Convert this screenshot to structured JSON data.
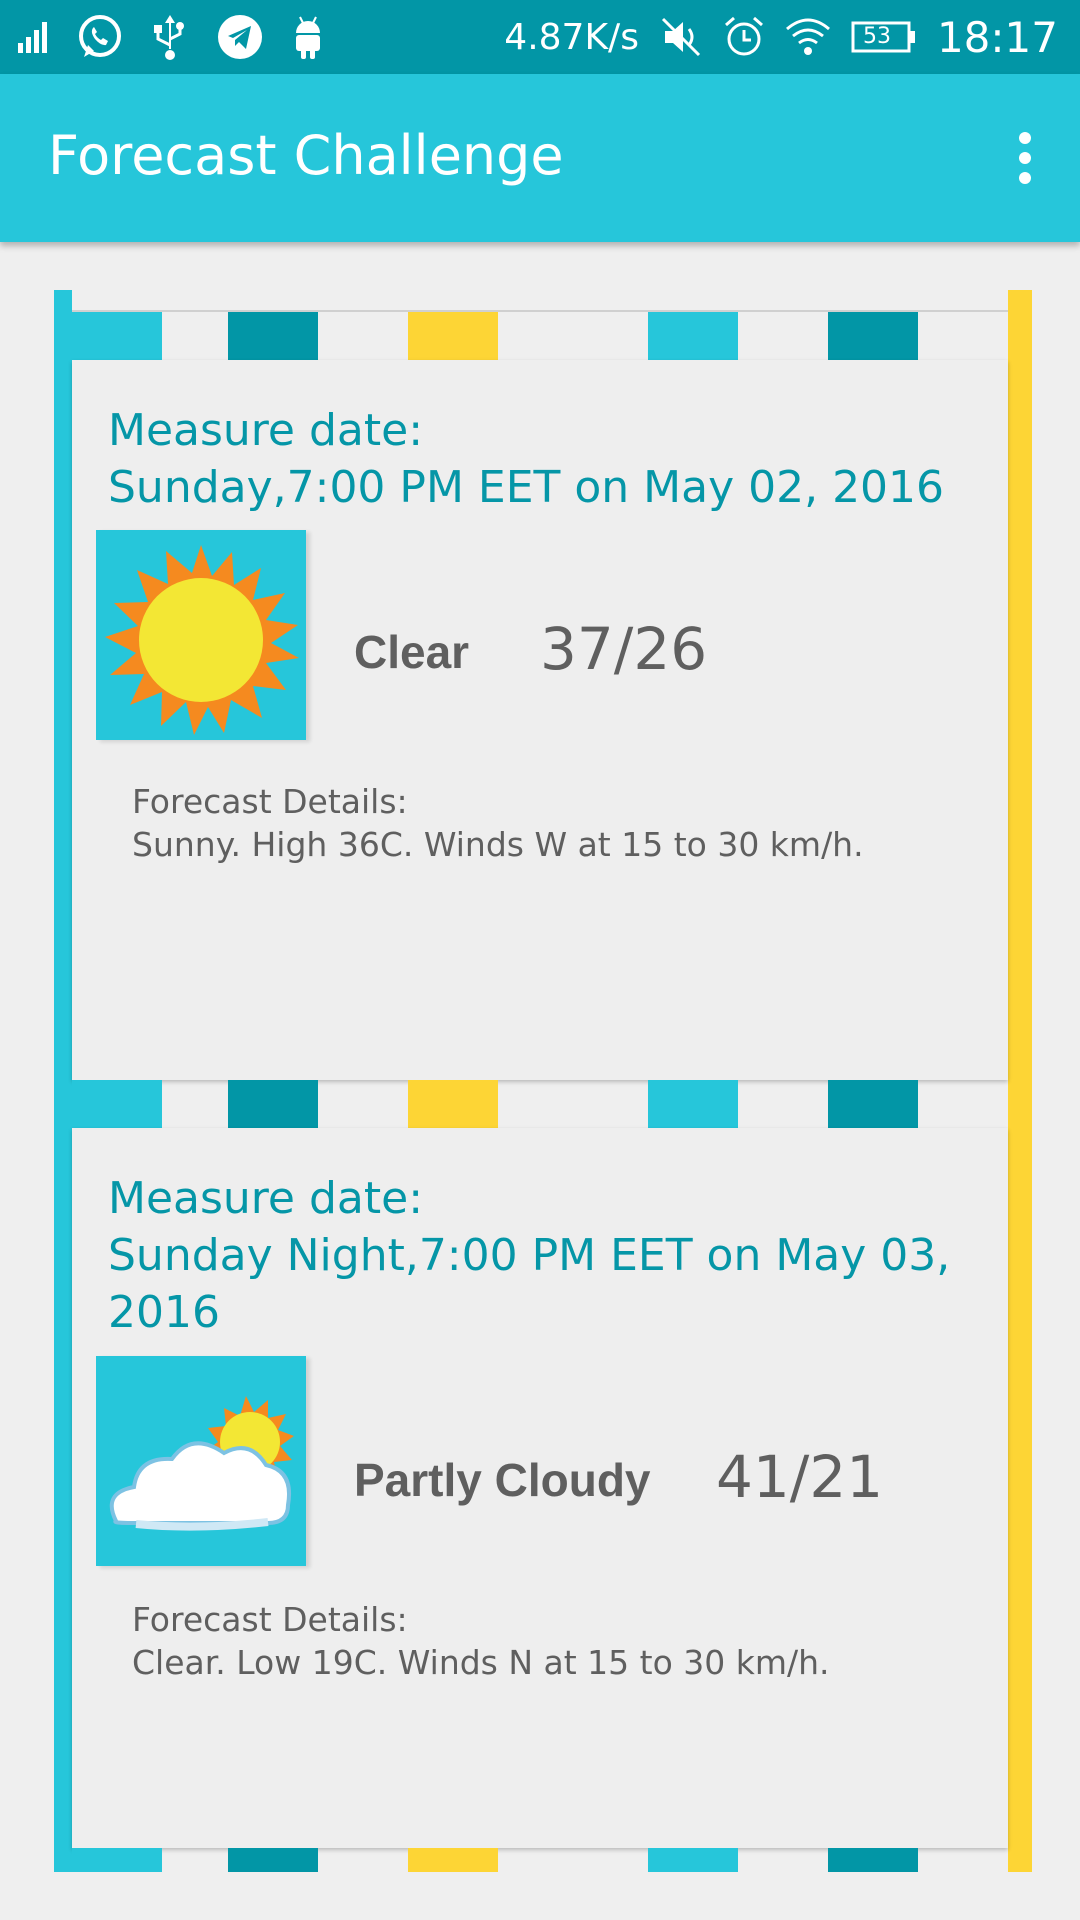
{
  "status_bar": {
    "speed": "4.87K/s",
    "battery": "53",
    "time": "18:17",
    "left_icons": [
      "signal-icon",
      "whatsapp-icon",
      "usb-icon",
      "telegram-icon",
      "android-icon"
    ],
    "right_icons": [
      "mute-icon",
      "alarm-icon",
      "wifi-icon",
      "battery-icon"
    ]
  },
  "app_bar": {
    "title": "Forecast Challenge",
    "menu_icon": "more-vert-icon"
  },
  "forecasts": [
    {
      "measure_label": "Measure date:",
      "measure_date": "Sunday,7:00 PM EET on May 02, 2016",
      "icon": "sunny-icon",
      "condition": "Clear",
      "temp": "37/26",
      "details_label": "Forecast Details:",
      "details": "Sunny. High 36C. Winds W at 15 to 30 km/h."
    },
    {
      "measure_label": "Measure date:",
      "measure_date": "Sunday Night,7:00 PM EET on May 03, 2016",
      "icon": "partly-cloudy-icon",
      "condition": "Partly Cloudy",
      "temp": "41/21",
      "details_label": "Forecast Details:",
      "details": "Clear. Low 19C. Winds N at 15 to 30 km/h."
    }
  ],
  "colors": {
    "status_bar": "#0296a6",
    "app_bar": "#26c6da",
    "accent_teal": "#0596a7",
    "accent_yellow": "#fdd535",
    "background": "#efefef",
    "text_gray": "#5f5f5f"
  }
}
